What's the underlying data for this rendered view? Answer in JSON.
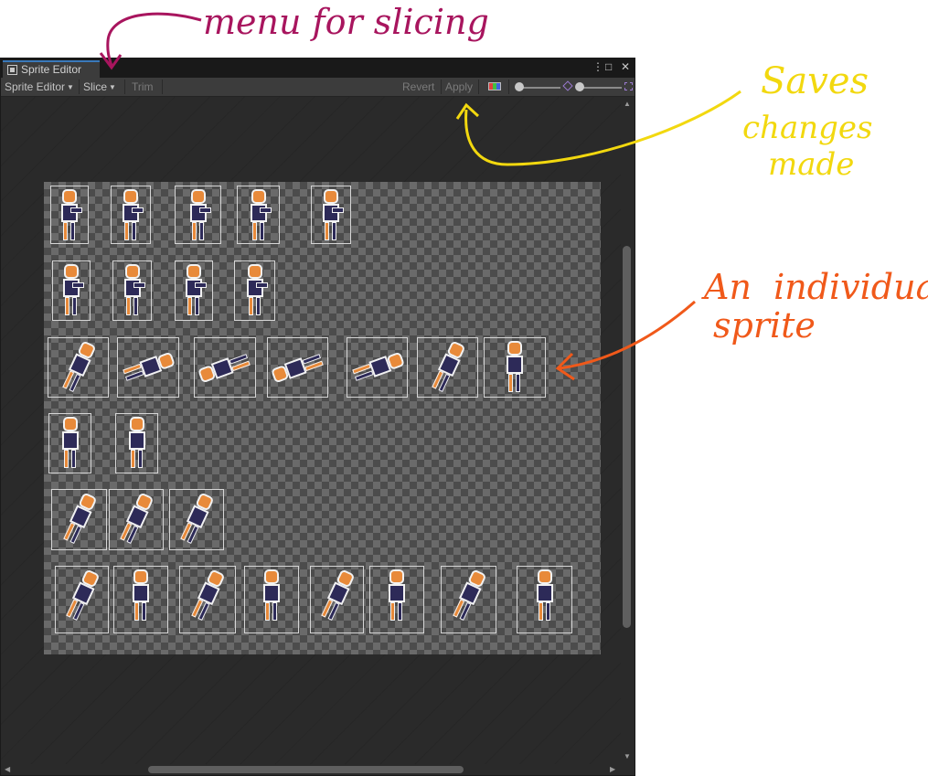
{
  "window": {
    "tab_title": "Sprite Editor",
    "menu_icon": "⋮",
    "maximize_icon": "□",
    "close_icon": "✕"
  },
  "toolbar": {
    "mode_label": "Sprite Editor",
    "slice_label": "Slice",
    "trim_label": "Trim",
    "revert_label": "Revert",
    "apply_label": "Apply"
  },
  "sheet": {
    "rows": [
      {
        "count": 5,
        "pose": "aim"
      },
      {
        "count": 4,
        "pose": "aim"
      },
      {
        "count": 7,
        "pose": "tumble"
      },
      {
        "count": 2,
        "pose": "idle"
      },
      {
        "count": 3,
        "pose": "crouch"
      },
      {
        "count": 8,
        "pose": "run"
      }
    ]
  },
  "annotations": {
    "menu": "menu for slicing",
    "apply_line1": "Saves",
    "apply_line2": "changes",
    "apply_line3": "made",
    "sprite_line1": "An  individual",
    "sprite_line2": "sprite"
  },
  "colors": {
    "menu_annotation": "#a8155e",
    "apply_annotation": "#f2d80f",
    "sprite_annotation": "#f0591a",
    "sprite_orange": "#e88a3a",
    "sprite_navy": "#2d2a58"
  }
}
